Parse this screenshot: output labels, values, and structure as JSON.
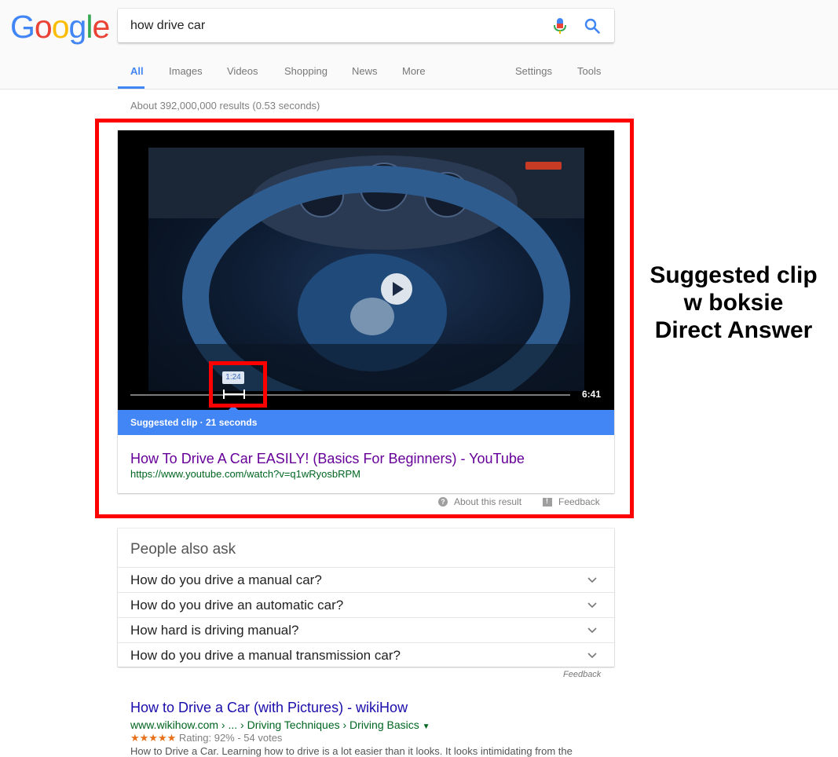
{
  "logo": {
    "letters": [
      "G",
      "o",
      "o",
      "g",
      "l",
      "e"
    ]
  },
  "search": {
    "query": "how drive car"
  },
  "tabs": [
    {
      "label": "All"
    },
    {
      "label": "Images"
    },
    {
      "label": "Videos"
    },
    {
      "label": "Shopping"
    },
    {
      "label": "News"
    },
    {
      "label": "More"
    },
    {
      "label": "Settings"
    },
    {
      "label": "Tools"
    }
  ],
  "result_stats": "About 392,000,000 results (0.53 seconds)",
  "featured": {
    "clip_time": "1:24",
    "duration": "6:41",
    "clip_bar": "Suggested clip · 21 seconds",
    "title": "How To Drive A Car EASILY! (Basics For Beginners) - YouTube",
    "url": "https://www.youtube.com/watch?v=q1wRyosbRPM",
    "about": "About this result",
    "feedback": "Feedback"
  },
  "annotation": {
    "line1": "Suggested clip",
    "line2": "w boksie",
    "line3": "Direct Answer"
  },
  "paa": {
    "title": "People also ask",
    "questions": [
      "How do you drive a manual car?",
      "How do you drive an automatic car?",
      "How hard is driving manual?",
      "How do you drive a manual transmission car?"
    ],
    "feedback": "Feedback"
  },
  "organic": {
    "title": "How to Drive a Car (with Pictures) - wikiHow",
    "url": "www.wikihow.com › ... › Driving Techniques › Driving Basics",
    "stars": "★★★★★",
    "rating": "Rating: 92% - 54 votes",
    "snippet": "How to Drive a Car. Learning how to drive is a lot easier than it looks. It looks intimidating from the"
  },
  "colors": {
    "accent": "#4285f4",
    "highlight": "#ff0000",
    "link": "#1a0dab",
    "visited": "#660099",
    "url": "#006621"
  }
}
